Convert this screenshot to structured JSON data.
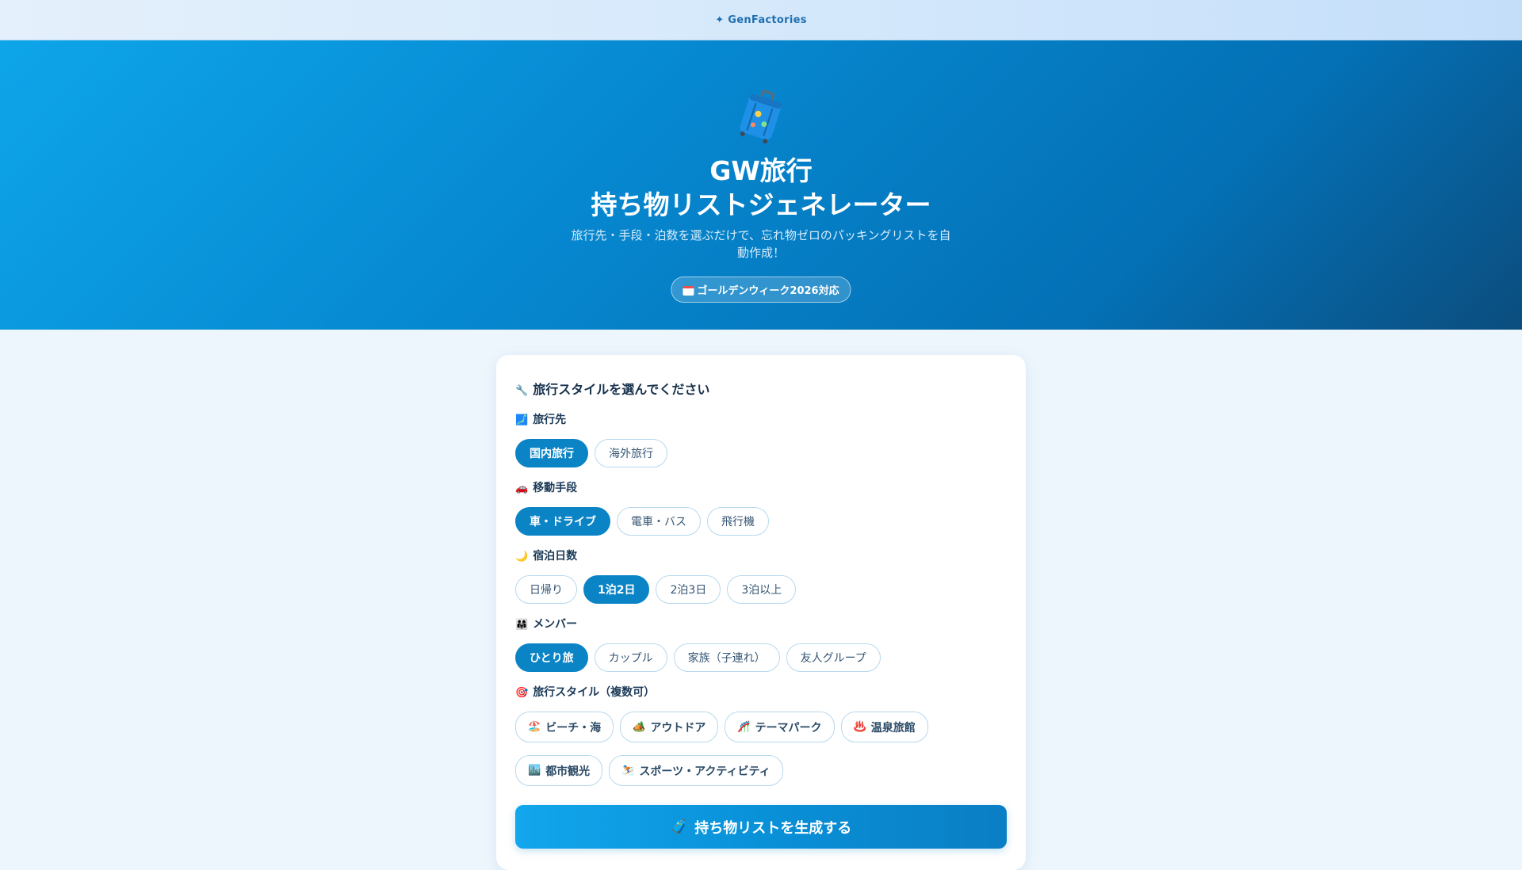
{
  "topbar": {
    "brand": "✦ GenFactories"
  },
  "hero": {
    "title_line1": "GW旅行",
    "title_line2": "持ち物リストジェネレーター",
    "description": "旅行先・手段・泊数を選ぶだけで、忘れ物ゼロのパッキングリストを自動作成！",
    "badge": "ゴールデンウィーク2026対応"
  },
  "form": {
    "title": "旅行スタイルを選んでください",
    "destination": {
      "label": "旅行先",
      "options": [
        "国内旅行",
        "海外旅行"
      ],
      "selected": "国内旅行"
    },
    "transport": {
      "label": "移動手段",
      "options": [
        "車・ドライブ",
        "電車・バス",
        "飛行機"
      ],
      "selected": "車・ドライブ"
    },
    "nights": {
      "label": "宿泊日数",
      "options": [
        "日帰り",
        "1泊2日",
        "2泊3日",
        "3泊以上"
      ],
      "selected": "1泊2日"
    },
    "members": {
      "label": "メンバー",
      "options": [
        "ひとり旅",
        "カップル",
        "家族（子連れ）",
        "友人グループ"
      ],
      "selected": "ひとり旅"
    },
    "styles": {
      "label": "旅行スタイル（複数可）",
      "options": [
        "ビーチ・海",
        "アウトドア",
        "テーマパーク",
        "温泉旅館",
        "都市観光",
        "スポーツ・アクティビティ"
      ]
    },
    "generate_label": "持ち物リストを生成する"
  },
  "colors": {
    "accent": "#0b84c6",
    "hero_start": "#0ea5e9",
    "hero_end": "#0b4d7e"
  }
}
